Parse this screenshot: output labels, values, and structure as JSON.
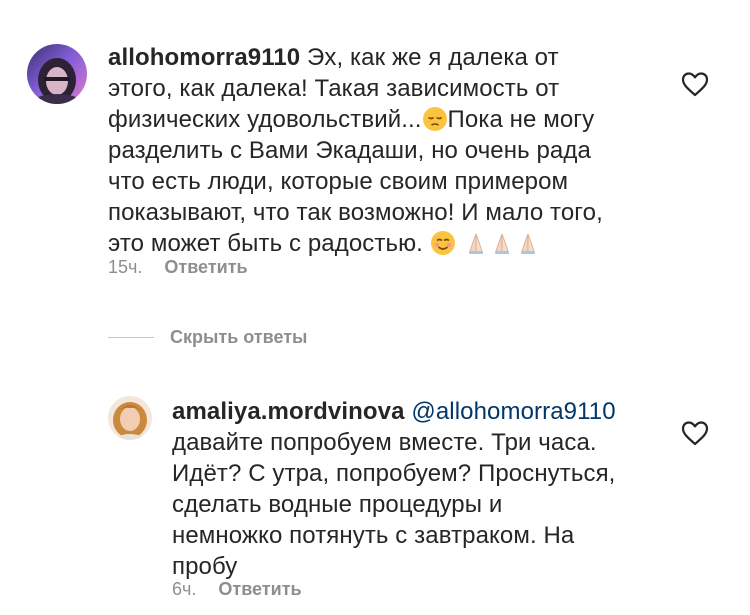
{
  "comment": {
    "username": "allohomorra9110",
    "text_line1": "Эх, как же я далека от",
    "text_line2": "этого, как далека! Такая зависимость от",
    "text_line3": "физических удовольствий...",
    "text_line4": "Пока не могу",
    "text_line5": "разделить с Вами Экадаши, но очень рада",
    "text_line6": "что есть люди, которые своим примером",
    "text_line7": "показывают, что так возможно! И мало того,",
    "text_line8": "это может быть с радостью.",
    "emoji1": "pensive-face",
    "emoji2": "smiling-face",
    "emoji3": "folded-hands",
    "time": "15ч.",
    "reply_label": "Ответить"
  },
  "hide_replies_label": "Скрыть ответы",
  "reply": {
    "username": "amaliya.mordvinova",
    "mention": "@allohomorra9110",
    "text_line1": "давайте попробуем вместе. Три часа.",
    "text_line2": "Идёт? С утра, попробуем? Проснуться,",
    "text_line3": "сделать водные процедуры и",
    "text_line4": "немножко потянуть с завтраком. На",
    "text_line5": "пробу",
    "time": "6ч.",
    "reply_label": "Ответить"
  },
  "colors": {
    "text": "#262626",
    "secondary": "#8e8e8e",
    "mention": "#00376b"
  }
}
